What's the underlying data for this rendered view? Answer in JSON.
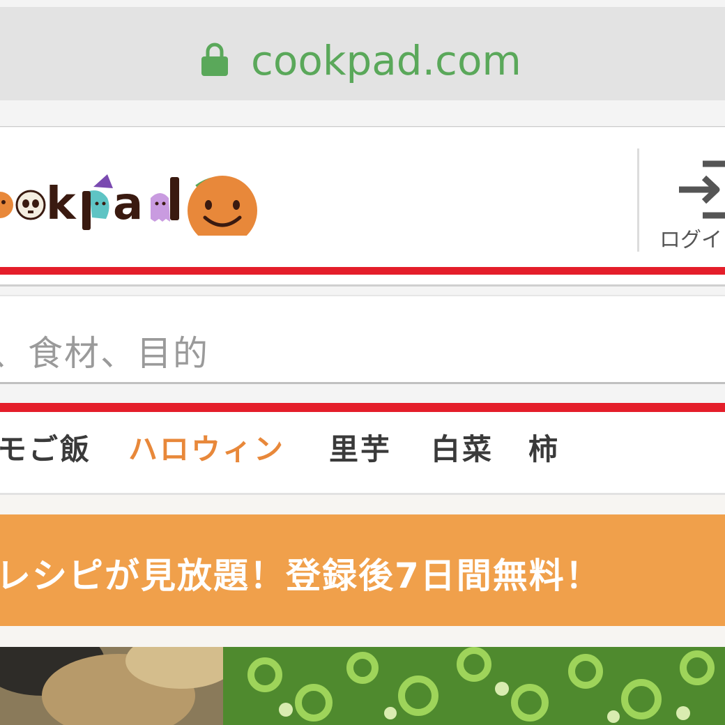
{
  "browser": {
    "url": "cookpad.com",
    "lock_icon": "lock-icon",
    "accent": "#5aa85a"
  },
  "header": {
    "logo_text": "ookpad",
    "logo_icon": "pumpkin-icon",
    "login_label": "ログイ",
    "login_icon": "login-arrow-icon"
  },
  "search": {
    "placeholder": "、食材、目的"
  },
  "keywords": [
    {
      "label": "モご飯",
      "active": false
    },
    {
      "label": "ハロウィン",
      "active": true
    },
    {
      "label": "里芋",
      "active": false
    },
    {
      "label": "白菜",
      "active": false
    },
    {
      "label": "柿",
      "active": false
    }
  ],
  "promo": {
    "text": "レシピが見放題！登録後7日間無料！",
    "color": "#f0a04b"
  },
  "colors": {
    "red_rule": "#e41e2a",
    "active_keyword": "#e8883a"
  }
}
